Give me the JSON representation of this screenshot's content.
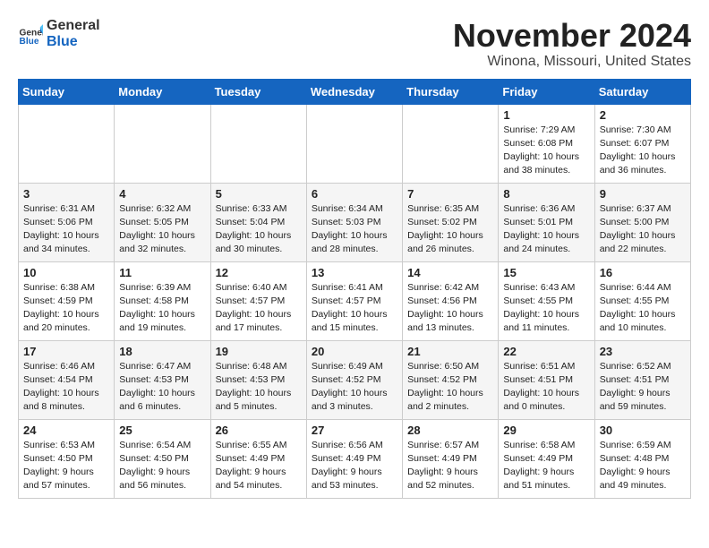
{
  "logo": {
    "general": "General",
    "blue": "Blue"
  },
  "header": {
    "month": "November 2024",
    "location": "Winona, Missouri, United States"
  },
  "days_of_week": [
    "Sunday",
    "Monday",
    "Tuesday",
    "Wednesday",
    "Thursday",
    "Friday",
    "Saturday"
  ],
  "weeks": [
    [
      {
        "day": "",
        "info": ""
      },
      {
        "day": "",
        "info": ""
      },
      {
        "day": "",
        "info": ""
      },
      {
        "day": "",
        "info": ""
      },
      {
        "day": "",
        "info": ""
      },
      {
        "day": "1",
        "info": "Sunrise: 7:29 AM\nSunset: 6:08 PM\nDaylight: 10 hours\nand 38 minutes."
      },
      {
        "day": "2",
        "info": "Sunrise: 7:30 AM\nSunset: 6:07 PM\nDaylight: 10 hours\nand 36 minutes."
      }
    ],
    [
      {
        "day": "3",
        "info": "Sunrise: 6:31 AM\nSunset: 5:06 PM\nDaylight: 10 hours\nand 34 minutes."
      },
      {
        "day": "4",
        "info": "Sunrise: 6:32 AM\nSunset: 5:05 PM\nDaylight: 10 hours\nand 32 minutes."
      },
      {
        "day": "5",
        "info": "Sunrise: 6:33 AM\nSunset: 5:04 PM\nDaylight: 10 hours\nand 30 minutes."
      },
      {
        "day": "6",
        "info": "Sunrise: 6:34 AM\nSunset: 5:03 PM\nDaylight: 10 hours\nand 28 minutes."
      },
      {
        "day": "7",
        "info": "Sunrise: 6:35 AM\nSunset: 5:02 PM\nDaylight: 10 hours\nand 26 minutes."
      },
      {
        "day": "8",
        "info": "Sunrise: 6:36 AM\nSunset: 5:01 PM\nDaylight: 10 hours\nand 24 minutes."
      },
      {
        "day": "9",
        "info": "Sunrise: 6:37 AM\nSunset: 5:00 PM\nDaylight: 10 hours\nand 22 minutes."
      }
    ],
    [
      {
        "day": "10",
        "info": "Sunrise: 6:38 AM\nSunset: 4:59 PM\nDaylight: 10 hours\nand 20 minutes."
      },
      {
        "day": "11",
        "info": "Sunrise: 6:39 AM\nSunset: 4:58 PM\nDaylight: 10 hours\nand 19 minutes."
      },
      {
        "day": "12",
        "info": "Sunrise: 6:40 AM\nSunset: 4:57 PM\nDaylight: 10 hours\nand 17 minutes."
      },
      {
        "day": "13",
        "info": "Sunrise: 6:41 AM\nSunset: 4:57 PM\nDaylight: 10 hours\nand 15 minutes."
      },
      {
        "day": "14",
        "info": "Sunrise: 6:42 AM\nSunset: 4:56 PM\nDaylight: 10 hours\nand 13 minutes."
      },
      {
        "day": "15",
        "info": "Sunrise: 6:43 AM\nSunset: 4:55 PM\nDaylight: 10 hours\nand 11 minutes."
      },
      {
        "day": "16",
        "info": "Sunrise: 6:44 AM\nSunset: 4:55 PM\nDaylight: 10 hours\nand 10 minutes."
      }
    ],
    [
      {
        "day": "17",
        "info": "Sunrise: 6:46 AM\nSunset: 4:54 PM\nDaylight: 10 hours\nand 8 minutes."
      },
      {
        "day": "18",
        "info": "Sunrise: 6:47 AM\nSunset: 4:53 PM\nDaylight: 10 hours\nand 6 minutes."
      },
      {
        "day": "19",
        "info": "Sunrise: 6:48 AM\nSunset: 4:53 PM\nDaylight: 10 hours\nand 5 minutes."
      },
      {
        "day": "20",
        "info": "Sunrise: 6:49 AM\nSunset: 4:52 PM\nDaylight: 10 hours\nand 3 minutes."
      },
      {
        "day": "21",
        "info": "Sunrise: 6:50 AM\nSunset: 4:52 PM\nDaylight: 10 hours\nand 2 minutes."
      },
      {
        "day": "22",
        "info": "Sunrise: 6:51 AM\nSunset: 4:51 PM\nDaylight: 10 hours\nand 0 minutes."
      },
      {
        "day": "23",
        "info": "Sunrise: 6:52 AM\nSunset: 4:51 PM\nDaylight: 9 hours\nand 59 minutes."
      }
    ],
    [
      {
        "day": "24",
        "info": "Sunrise: 6:53 AM\nSunset: 4:50 PM\nDaylight: 9 hours\nand 57 minutes."
      },
      {
        "day": "25",
        "info": "Sunrise: 6:54 AM\nSunset: 4:50 PM\nDaylight: 9 hours\nand 56 minutes."
      },
      {
        "day": "26",
        "info": "Sunrise: 6:55 AM\nSunset: 4:49 PM\nDaylight: 9 hours\nand 54 minutes."
      },
      {
        "day": "27",
        "info": "Sunrise: 6:56 AM\nSunset: 4:49 PM\nDaylight: 9 hours\nand 53 minutes."
      },
      {
        "day": "28",
        "info": "Sunrise: 6:57 AM\nSunset: 4:49 PM\nDaylight: 9 hours\nand 52 minutes."
      },
      {
        "day": "29",
        "info": "Sunrise: 6:58 AM\nSunset: 4:49 PM\nDaylight: 9 hours\nand 51 minutes."
      },
      {
        "day": "30",
        "info": "Sunrise: 6:59 AM\nSunset: 4:48 PM\nDaylight: 9 hours\nand 49 minutes."
      }
    ]
  ]
}
